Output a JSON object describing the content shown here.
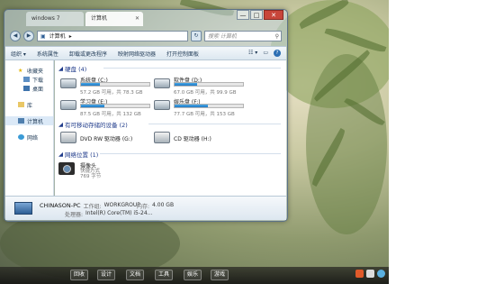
{
  "window": {
    "tabs": [
      {
        "label": "windows 7"
      },
      {
        "label": "计算机"
      }
    ],
    "controls": {
      "minimize": "—",
      "maximize": "□",
      "close": "✕"
    }
  },
  "address": {
    "path": [
      "计算机",
      "▸"
    ],
    "search_placeholder": "搜索 计算机"
  },
  "toolbar": {
    "organize": "组织 ▾",
    "properties": "系统属性",
    "uninstall": "卸载或更改程序",
    "map_drive": "映射网络驱动器",
    "control_panel": "打开控制面板"
  },
  "navpane": {
    "favorites": "收藏夹",
    "downloads": "下载",
    "desktop": "桌面",
    "libraries": "库",
    "computer": "计算机",
    "network": "网络"
  },
  "content": {
    "hdd_header": "硬盘 (4)",
    "drives": [
      {
        "name": "系统盘 (C:)",
        "free": "57.2 GB 可用，共 78.3 GB",
        "used_fraction": 0.27
      },
      {
        "name": "软件盘 (D:)",
        "free": "67.0 GB 可用，共 99.9 GB",
        "used_fraction": 0.33
      },
      {
        "name": "学习盘 (E:)",
        "free": "87.5 GB 可用，共 132 GB",
        "used_fraction": 0.34
      },
      {
        "name": "娱乐盘 (F:)",
        "free": "77.7 GB 可用，共 153 GB",
        "used_fraction": 0.49
      }
    ],
    "removable_header": "有可移动存储的设备 (2)",
    "devices": [
      {
        "name": "DVD RW 驱动器 (G:)"
      },
      {
        "name": "CD 驱动器 (H:)"
      }
    ],
    "network_header": "网络位置 (1)",
    "network_item": {
      "name": "摄像头",
      "type": "快捷方式",
      "size": "769 字节"
    }
  },
  "details": {
    "pc_name": "CHINASON-PC",
    "workgroup_label": "工作组:",
    "workgroup": "WORKGROUP",
    "memory_label": "内存:",
    "memory": "4.00 GB",
    "cpu_label": "处理器:",
    "cpu": "Intel(R) Core(TM) i5-24..."
  },
  "taskbar": {
    "items": [
      "回收",
      "设计",
      "文档",
      "工具",
      "娱乐",
      "游戏"
    ]
  }
}
